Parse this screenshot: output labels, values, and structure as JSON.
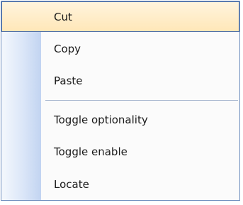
{
  "context_menu": {
    "items": [
      {
        "label": "Cut"
      },
      {
        "label": "Copy"
      },
      {
        "label": "Paste"
      },
      {
        "label": "Toggle optionality"
      },
      {
        "label": "Toggle enable"
      },
      {
        "label": "Locate"
      }
    ],
    "highlighted_item": "Cut",
    "colors": {
      "highlight_top": "#fff4dd",
      "highlight_bottom": "#ffe7b8",
      "highlight_border": "#4d6fa8",
      "gutter": "#c2d4f1",
      "border": "#6d8dbd",
      "separator": "#a9b8d0"
    }
  }
}
